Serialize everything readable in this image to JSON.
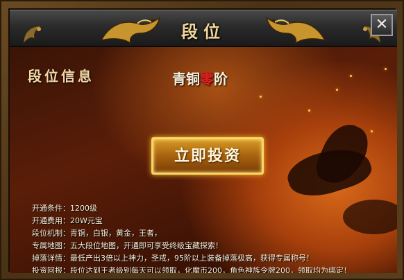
{
  "window": {
    "title": "段位",
    "close_label": "✕"
  },
  "panel": {
    "section_title": "段位信息",
    "rank_prefix": "青铜",
    "rank_number": "零",
    "rank_suffix": "阶",
    "invest_button": "立即投资"
  },
  "info_lines": [
    "开通条件：1200级",
    "开通费用：20W元宝",
    "段位机制：青铜，白银，黄金，王者，",
    "专属地图：五大段位地图，开通即可享受终级宝藏探索！",
    "掉落详情：最低产出3倍以上神力，圣戒，95阶以上装备掉落极高，获得专属称号！",
    "投资回报：段位达到王者级别每天可以领取，化魔币200，角色神族令牌200，领取均为绑定！"
  ],
  "colors": {
    "title_gold": "#f2d89a",
    "rank_number_red": "#e02020",
    "button_border": "#f8d860"
  },
  "icons": {
    "close": "close-icon",
    "dragon": "dragon-ornament-icon"
  }
}
